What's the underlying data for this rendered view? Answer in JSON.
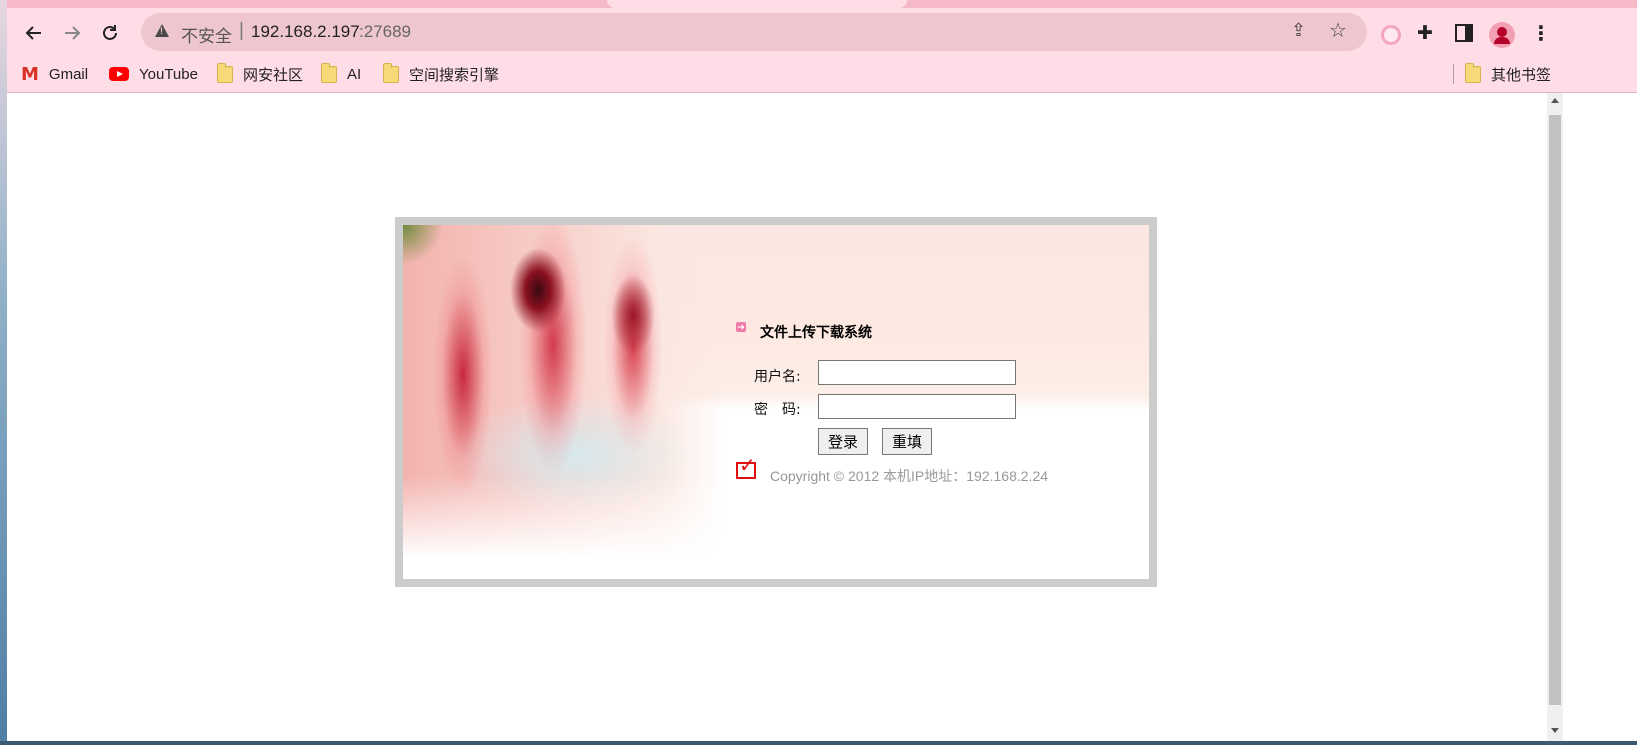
{
  "browser": {
    "security_label": "不安全",
    "url_host": "192.168.2.197",
    "url_port": ":27689",
    "separator": "|"
  },
  "bookmarks": {
    "items": [
      {
        "label": "Gmail",
        "icon": "gmail-icon"
      },
      {
        "label": "YouTube",
        "icon": "youtube-icon"
      },
      {
        "label": "网安社区",
        "icon": "folder-icon"
      },
      {
        "label": "AI",
        "icon": "folder-icon"
      },
      {
        "label": "空间搜索引擎",
        "icon": "folder-icon"
      }
    ],
    "other": "其他书签"
  },
  "login": {
    "title": "文件上传下载系统",
    "username_label": "用户名:",
    "password_label": "密　码:",
    "username_value": "",
    "password_value": "",
    "login_button": "登录",
    "reset_button": "重填",
    "copyright": "Copyright © 2012 本机IP地址：192.168.2.24"
  },
  "colors": {
    "toolbar_bg": "#ffdde6",
    "omnibox_bg": "#eec6d0",
    "accent_red": "#e01010",
    "panel_border": "#cccccc"
  }
}
